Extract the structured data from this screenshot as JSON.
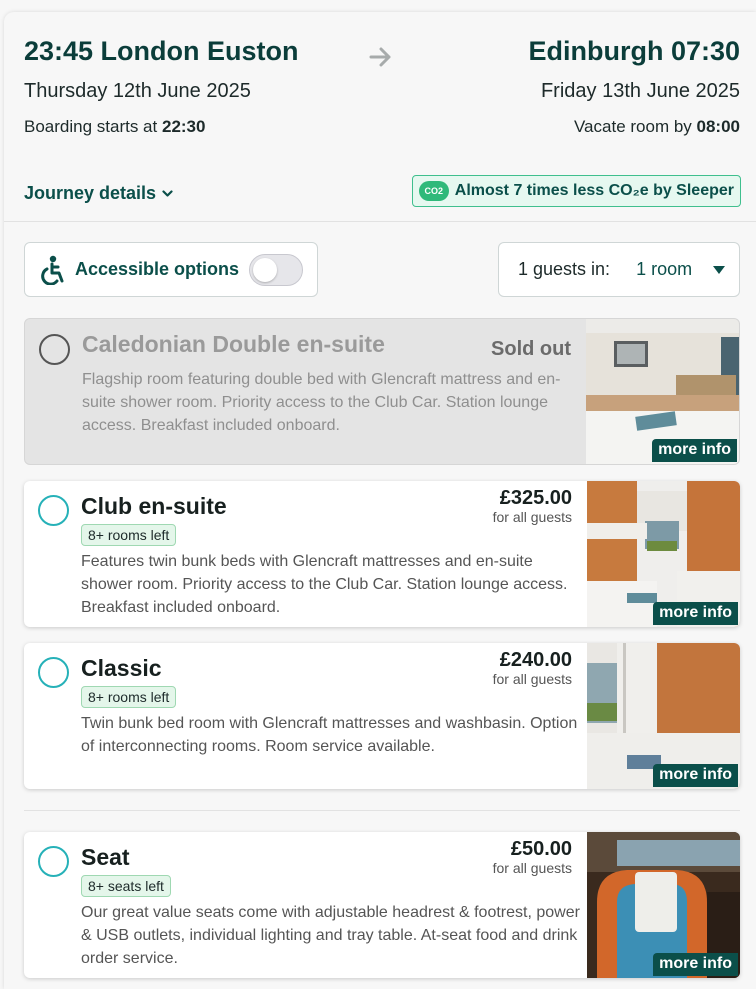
{
  "header": {
    "departure": "23:45 London Euston",
    "arrival": "Edinburgh 07:30",
    "departure_date": "Thursday 12th June 2025",
    "arrival_date": "Friday 13th June 2025",
    "boarding_prefix": "Boarding starts at",
    "boarding_time": "22:30",
    "vacate_prefix": "Vacate room by",
    "vacate_time": "08:00"
  },
  "journey_details": "Journey details",
  "co2": {
    "icon_text": "CO2",
    "text": "Almost 7 times less CO₂e by Sleeper"
  },
  "accessible": {
    "label": "Accessible options",
    "enabled": false
  },
  "guests": {
    "label": "1 guests in:",
    "value": "1 room"
  },
  "rooms": [
    {
      "title": "Caledonian Double en-suite",
      "status": "Sold out",
      "description": "Flagship room featuring double bed with Glencraft mattress and en-suite shower room. Priority access to the Club Car. Station lounge access. Breakfast included onboard.",
      "more_info": "more info"
    },
    {
      "title": "Club en-suite",
      "price": "£325.00",
      "price_sub": "for all guests",
      "badge": "8+ rooms left",
      "description": "Features twin bunk beds with Glencraft mattresses and en-suite shower room. Priority access to the Club Car. Station lounge access. Breakfast included onboard.",
      "more_info": "more info"
    },
    {
      "title": "Classic",
      "price": "£240.00",
      "price_sub": "for all guests",
      "badge": "8+ rooms left",
      "description": "Twin bunk bed room with Glencraft mattresses and washbasin. Option of interconnecting rooms. Room service available.",
      "more_info": "more info"
    },
    {
      "title": "Seat",
      "price": "£50.00",
      "price_sub": "for all guests",
      "badge": "8+ seats left",
      "description": "Our great value seats come with adjustable headrest & footrest, power & USB outlets, individual lighting and tray table. At-seat food and drink order service.",
      "more_info": "more info"
    }
  ],
  "colors": {
    "brand": "#0b4f4a",
    "radio": "#26b1b8",
    "badge_bg": "#e4f6ea",
    "co2_bg": "#e6f8f0"
  }
}
